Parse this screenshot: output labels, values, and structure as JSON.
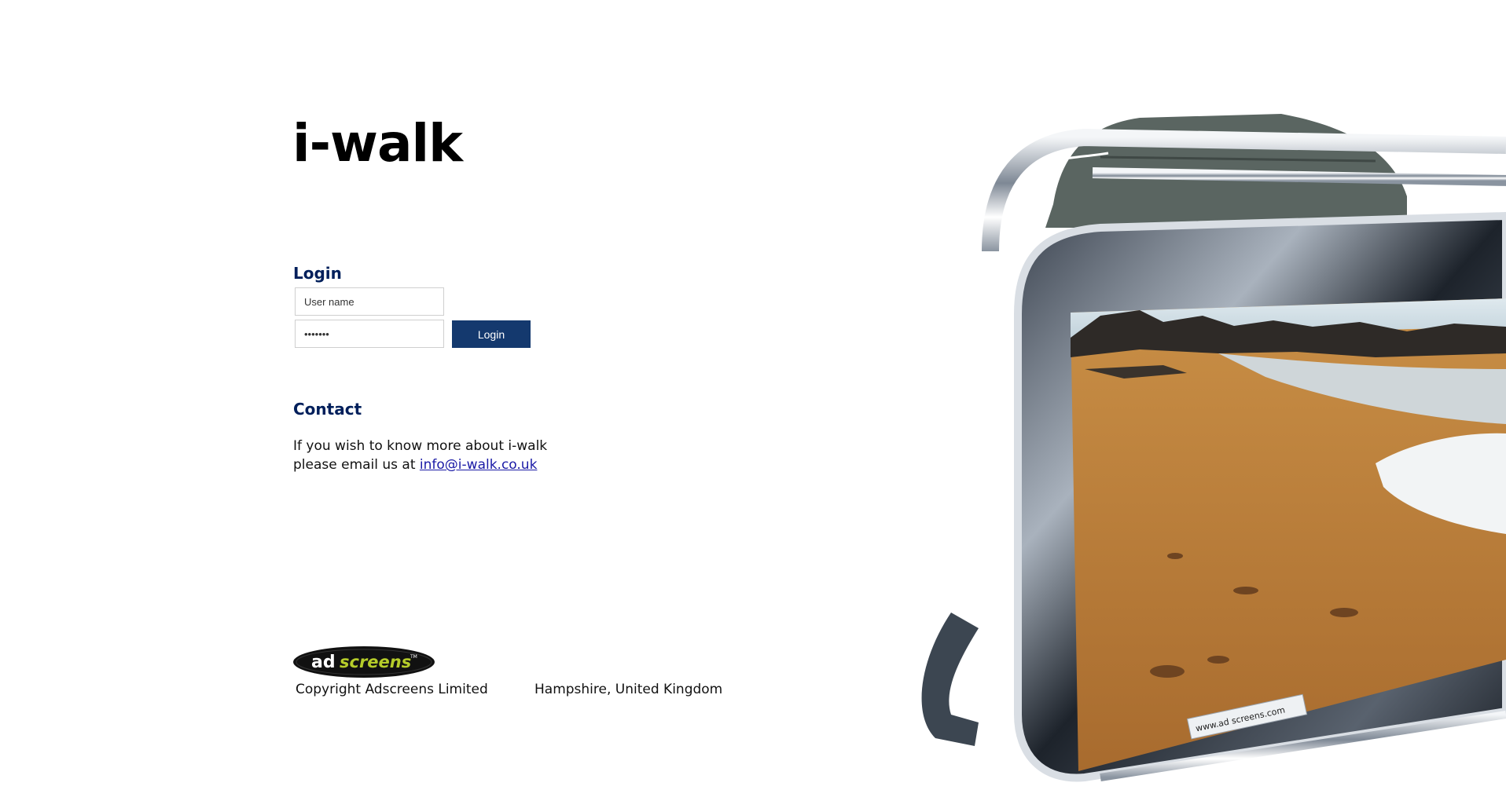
{
  "brand": {
    "title": "i-walk"
  },
  "login": {
    "heading": "Login",
    "username_placeholder": "User name",
    "password_value": "*******",
    "button_label": "Login"
  },
  "contact": {
    "heading": "Contact",
    "line1": "If you wish to know more about i-walk",
    "line2_prefix": "please email us at",
    "email": "info@i-walk.co.uk"
  },
  "footer": {
    "logo_text_ad": "ad",
    "logo_text_screens": "screens",
    "logo_tm": "TM",
    "copyright": "Copyright Adscreens Limited",
    "location": "Hampshire, United Kingdom"
  },
  "hero": {
    "sign_text": "www.ad screens.com"
  },
  "colors": {
    "heading": "#001f5b",
    "button": "#14396e",
    "link": "#1a1aa6"
  }
}
